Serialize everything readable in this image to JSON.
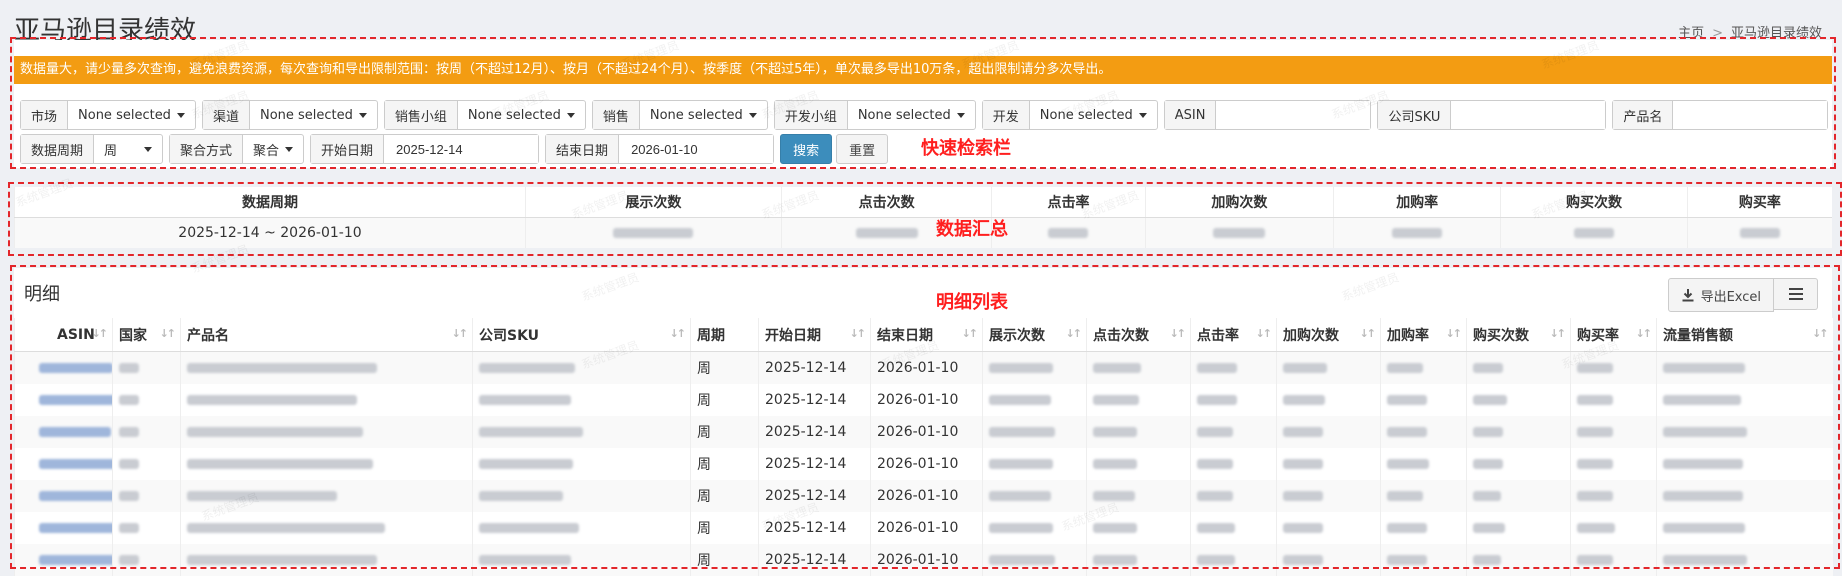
{
  "header": {
    "title": "亚马逊目录绩效",
    "breadcrumb": [
      "主页",
      "亚马逊目录绩效"
    ]
  },
  "watermark": "系统管理员",
  "notice": "数据量大，请少量多次查询，避免浪费资源，每次查询和导出限制范围：按周（不超过12月）、按月（不超过24个月）、按季度（不超过5年），单次最多导出10万条，超出限制请分多次导出。",
  "filters": {
    "row1": [
      {
        "label": "市场",
        "value": "None selected"
      },
      {
        "label": "渠道",
        "value": "None selected"
      },
      {
        "label": "销售小组",
        "value": "None selected"
      },
      {
        "label": "销售",
        "value": "None selected"
      },
      {
        "label": "开发小组",
        "value": "None selected"
      },
      {
        "label": "开发",
        "value": "None selected"
      }
    ],
    "inputs": [
      {
        "label": "ASIN",
        "value": ""
      },
      {
        "label": "公司SKU",
        "value": ""
      },
      {
        "label": "产品名",
        "value": ""
      }
    ],
    "period": {
      "label": "数据周期",
      "value": "周"
    },
    "aggregate": {
      "label": "聚合方式",
      "value": "聚合"
    },
    "start_date": {
      "label": "开始日期",
      "value": "2025-12-14"
    },
    "end_date": {
      "label": "结束日期",
      "value": "2026-01-10"
    },
    "search_label": "搜索",
    "reset_label": "重置"
  },
  "annotations": {
    "search": "快速检索栏",
    "summary": "数据汇总",
    "detail": "明细列表"
  },
  "summary": {
    "headers": [
      "数据周期",
      "展示次数",
      "点击次数",
      "点击率",
      "加购次数",
      "加购率",
      "购买次数",
      "购买率"
    ],
    "row": [
      "2025-12-14 ~ 2026-01-10",
      "",
      "",
      "",
      "",
      "",
      "",
      ""
    ]
  },
  "detail": {
    "title": "明细",
    "export_label": "导出Excel",
    "headers": [
      "ASIN",
      "国家",
      "产品名",
      "公司SKU",
      "周期",
      "开始日期",
      "结束日期",
      "展示次数",
      "点击次数",
      "点击率",
      "加购次数",
      "加购率",
      "购买次数",
      "购买率",
      "流量销售额"
    ],
    "rows": [
      {
        "period": "周",
        "start": "2025-12-14",
        "end": "2026-01-10"
      },
      {
        "period": "周",
        "start": "2025-12-14",
        "end": "2026-01-10"
      },
      {
        "period": "周",
        "start": "2025-12-14",
        "end": "2026-01-10"
      },
      {
        "period": "周",
        "start": "2025-12-14",
        "end": "2026-01-10"
      },
      {
        "period": "周",
        "start": "2025-12-14",
        "end": "2026-01-10"
      },
      {
        "period": "周",
        "start": "2025-12-14",
        "end": "2026-01-10"
      },
      {
        "period": "周",
        "start": "2025-12-14",
        "end": "2026-01-10"
      }
    ]
  },
  "icons": {
    "export": "download-icon",
    "menu": "menu-icon"
  },
  "colors": {
    "notice_bg": "#f39c12",
    "primary": "#3c8dbc",
    "annotation": "#e3262b"
  }
}
